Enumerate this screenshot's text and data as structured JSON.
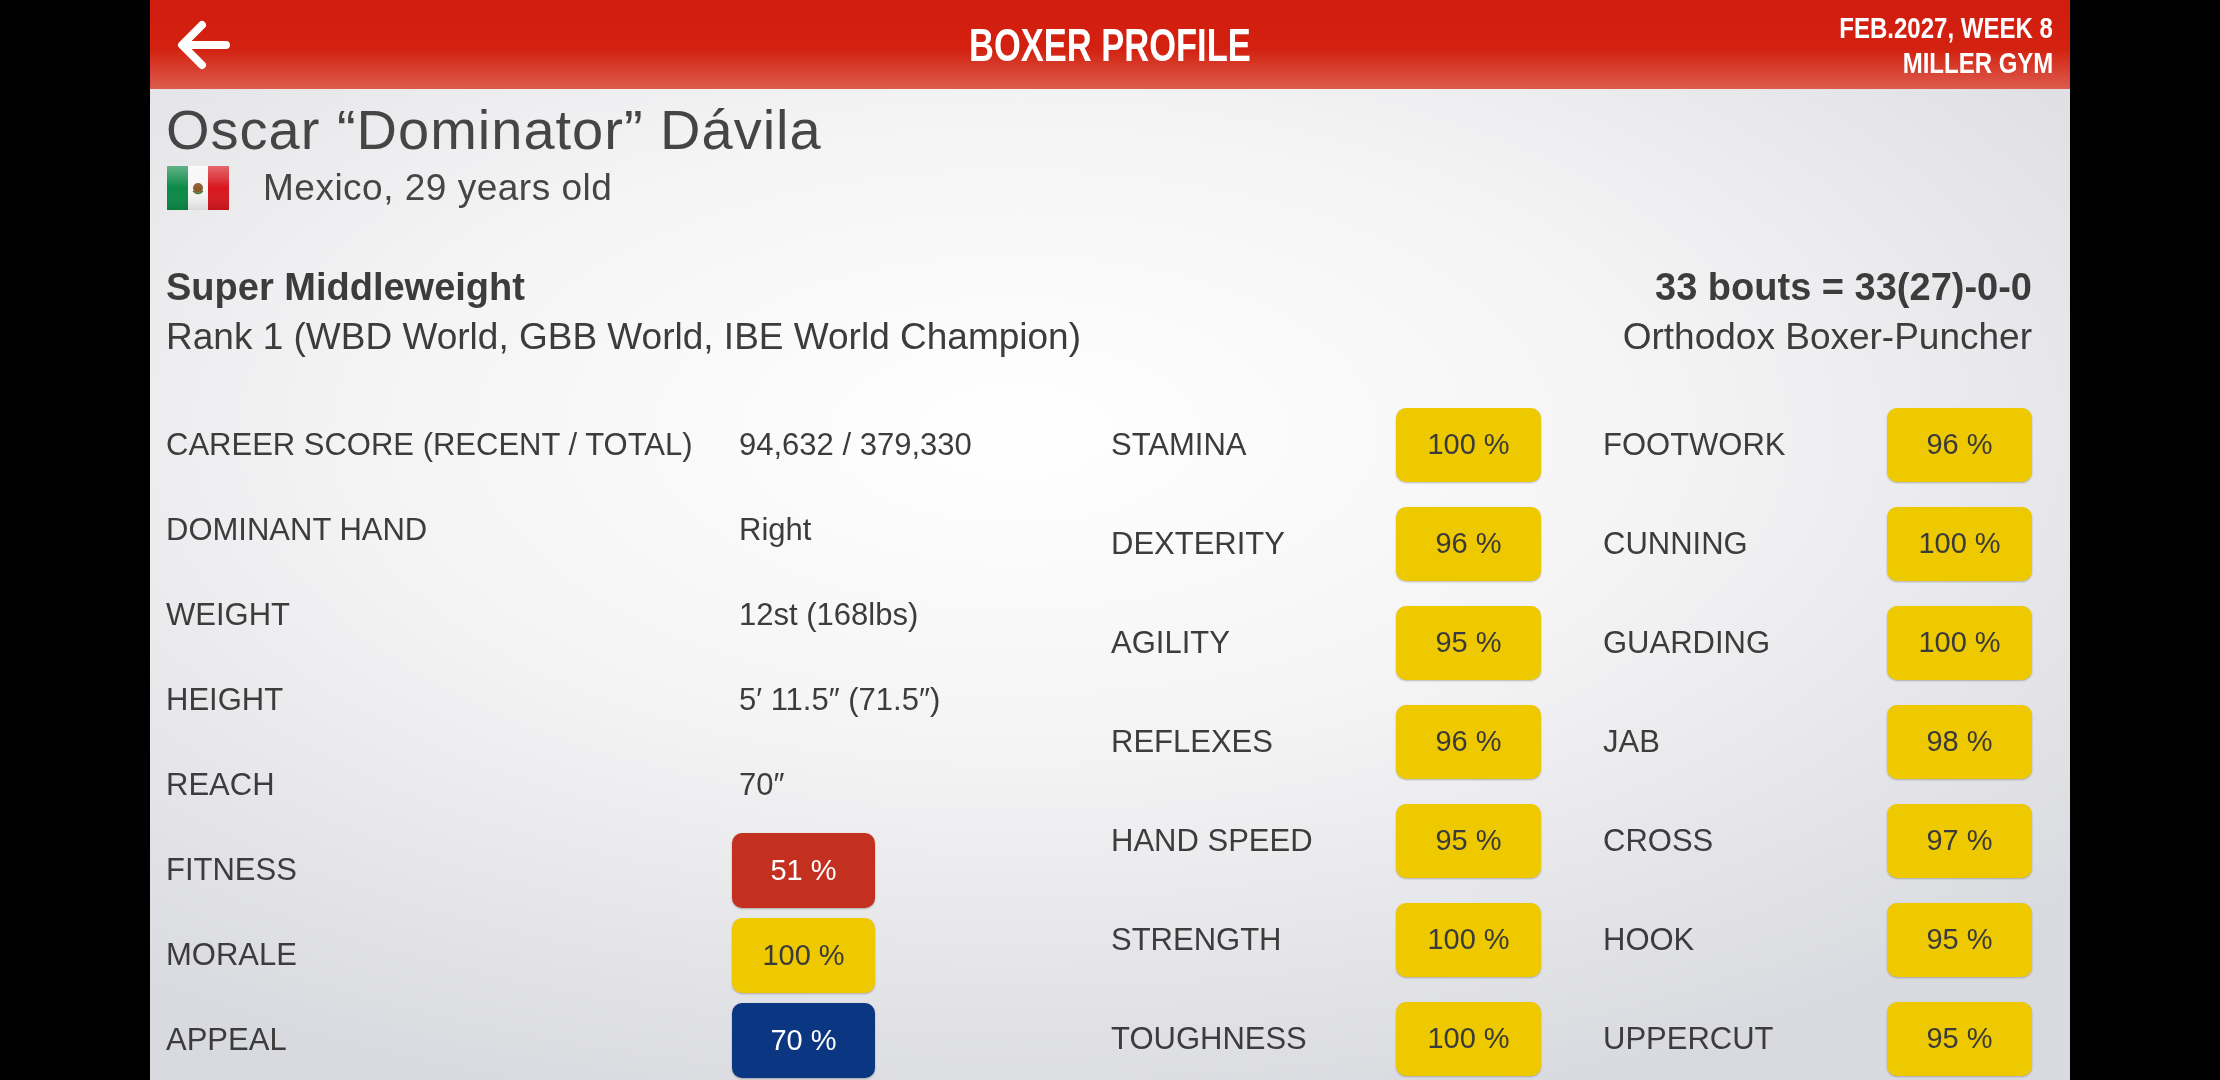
{
  "header": {
    "title": "BOXER PROFILE",
    "date": "FEB.2027, WEEK 8",
    "gym": "MILLER GYM"
  },
  "boxer": {
    "name": "Oscar “Dominator” Dávila",
    "origin": "Mexico, 29 years old",
    "weight_class": "Super Middleweight",
    "rank": "Rank 1 (WBD World, GBB World, IBE World Champion)",
    "record": "33 bouts = 33(27)-0-0",
    "style": "Orthodox Boxer-Puncher"
  },
  "details": [
    {
      "label": "CAREER SCORE (RECENT / TOTAL)",
      "kind": "text",
      "value": "94,632 / 379,330"
    },
    {
      "label": "DOMINANT HAND",
      "kind": "text",
      "value": "Right"
    },
    {
      "label": "WEIGHT",
      "kind": "text",
      "value": "12st (168lbs)"
    },
    {
      "label": "HEIGHT",
      "kind": "text",
      "value": "5′ 11.5″ (71.5″)"
    },
    {
      "label": "REACH",
      "kind": "text",
      "value": "70″"
    },
    {
      "label": "FITNESS",
      "kind": "badge",
      "value": "51 %",
      "color": "#c3301f"
    },
    {
      "label": "MORALE",
      "kind": "badge",
      "value": "100 %",
      "color": "#eec900"
    },
    {
      "label": "APPEAL",
      "kind": "badge",
      "value": "70 %",
      "color": "#0b3682"
    }
  ],
  "attributes": [
    {
      "items": [
        {
          "label": "STAMINA",
          "value": "100 %",
          "color": "#eec900"
        },
        {
          "label": "DEXTERITY",
          "value": "96 %",
          "color": "#eec900"
        },
        {
          "label": "AGILITY",
          "value": "95 %",
          "color": "#eec900"
        },
        {
          "label": "REFLEXES",
          "value": "96 %",
          "color": "#eec900"
        },
        {
          "label": "HAND SPEED",
          "value": "95 %",
          "color": "#eec900"
        },
        {
          "label": "STRENGTH",
          "value": "100 %",
          "color": "#eec900"
        },
        {
          "label": "TOUGHNESS",
          "value": "100 %",
          "color": "#eec900"
        }
      ]
    },
    {
      "items": [
        {
          "label": "FOOTWORK",
          "value": "96 %",
          "color": "#eec900"
        },
        {
          "label": "CUNNING",
          "value": "100 %",
          "color": "#eec900"
        },
        {
          "label": "GUARDING",
          "value": "100 %",
          "color": "#eec900"
        },
        {
          "label": "JAB",
          "value": "98 %",
          "color": "#eec900"
        },
        {
          "label": "CROSS",
          "value": "97 %",
          "color": "#eec900"
        },
        {
          "label": "HOOK",
          "value": "95 %",
          "color": "#eec900"
        },
        {
          "label": "UPPERCUT",
          "value": "95 %",
          "color": "#eec900"
        }
      ]
    }
  ]
}
